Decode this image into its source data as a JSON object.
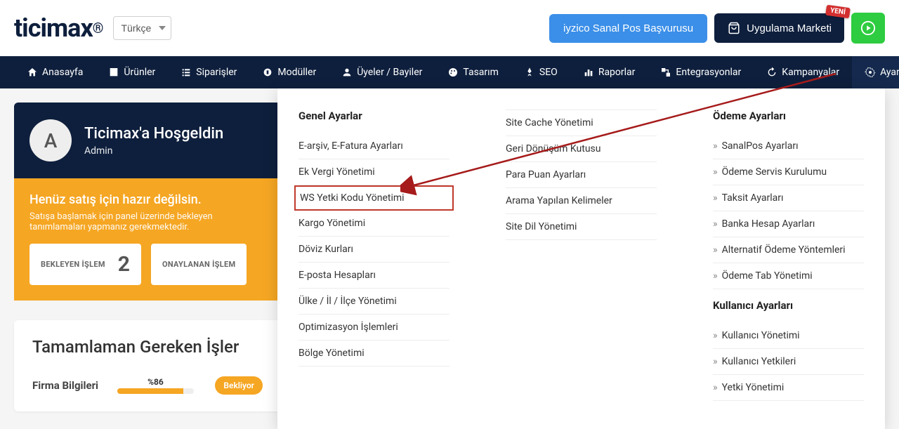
{
  "brand": "ticimax",
  "language": {
    "selected": "Türkçe"
  },
  "top_buttons": {
    "iyzico": "iyzico Sanal Pos Başvurusu",
    "market": "Uygulama Marketi",
    "market_badge": "YENİ"
  },
  "nav": [
    "Anasayfa",
    "Ürünler",
    "Siparişler",
    "Modüller",
    "Üyeler / Bayiler",
    "Tasarım",
    "SEO",
    "Raporlar",
    "Entegrasyonlar",
    "Kampanyalar",
    "Ayarlar"
  ],
  "welcome": {
    "avatar_letter": "A",
    "title": "Ticimax'a Hoşgeldin",
    "role": "Admin"
  },
  "notice": {
    "title": "Henüz satış için hazır değilsin.",
    "subtitle": "Satışa başlamak için panel üzerinde bekleyen tanımlamaları yapmanız gerekmektedir.",
    "stats": [
      {
        "label": "BEKLEYEN İŞLEM",
        "value": "2"
      },
      {
        "label": "ONAYLANAN İŞLEM",
        "value": ""
      }
    ]
  },
  "tasks": {
    "heading": "Tamamlaman Gereken İşler",
    "items": [
      {
        "name": "Firma Bilgileri",
        "pct_label": "%86",
        "pct": 86,
        "status": "Bekliyor"
      }
    ]
  },
  "dropdown": {
    "col1": {
      "heading": "Genel Ayarlar",
      "items": [
        "E-arşiv, E-Fatura Ayarları",
        "Ek Vergi Yönetimi",
        "WS Yetki Kodu Yönetimi",
        "Kargo Yönetimi",
        "Döviz Kurları",
        "E-posta Hesapları",
        "Ülke / İl / İlçe Yönetimi",
        "Optimizasyon İşlemleri",
        "Bölge Yönetimi"
      ],
      "highlight_index": 2
    },
    "col2": {
      "items": [
        "Site Cache Yönetimi",
        "Geri Dönüşüm Kutusu",
        "Para Puan Ayarları",
        "Arama Yapılan Kelimeler",
        "Site Dil Yönetimi"
      ]
    },
    "col3": {
      "sections": [
        {
          "heading": "Ödeme Ayarları",
          "items": [
            "SanalPos Ayarları",
            "Ödeme Servis Kurulumu",
            "Taksit Ayarları",
            "Banka Hesap Ayarları",
            "Alternatif Ödeme Yöntemleri",
            "Ödeme Tab Yönetimi"
          ]
        },
        {
          "heading": "Kullanıcı Ayarları",
          "items": [
            "Kullanıcı Yönetimi",
            "Kullanıcı Yetkileri",
            "Yetki Yönetimi"
          ]
        }
      ]
    }
  }
}
